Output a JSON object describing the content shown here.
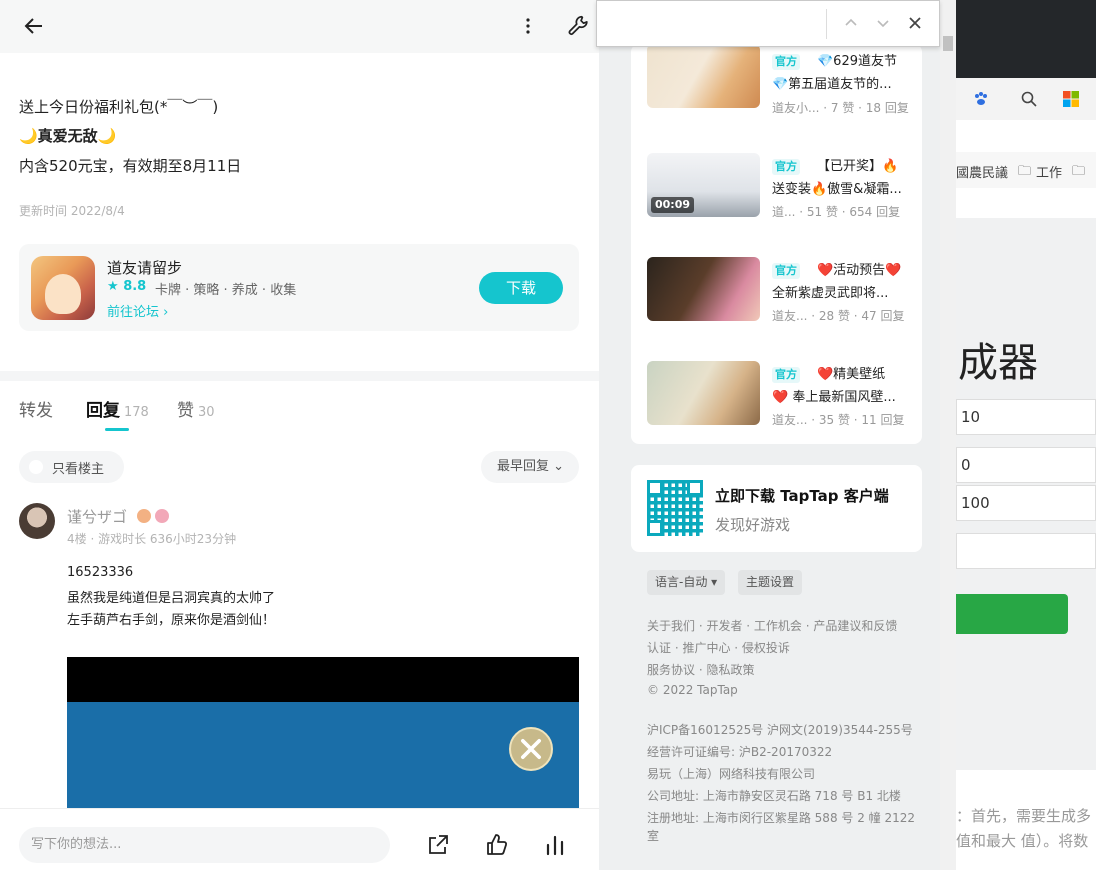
{
  "post": {
    "line1": "送上今日份福利礼包(*￣︶￣)",
    "line2": "🌙真爱无敌🌙",
    "line3": "内含520元宝，有效期至8月11日",
    "updated": "更新时间 2022/8/4"
  },
  "game": {
    "name": "道友请留步",
    "rating": "8.8",
    "tags": "卡牌 · 策略 · 养成 · 收集",
    "forum_link": "前往论坛 ›",
    "download_label": "下载"
  },
  "tabs": [
    {
      "label": "转发",
      "count": ""
    },
    {
      "label": "回复",
      "count": "178"
    },
    {
      "label": "赞",
      "count": "30"
    }
  ],
  "filters": {
    "only_owner": "只看楼主",
    "sort": "最早回复"
  },
  "comment": {
    "username": "谨兮ザゴ",
    "meta": "4楼 · 游戏时长 636小时23分钟",
    "lines": [
      "16523336",
      "虽然我是纯道但是吕洞宾真的太帅了",
      "左手葫芦右手剑，原来你是酒剑仙！"
    ]
  },
  "reply_placeholder": "写下你的想法...",
  "sidebar": {
    "posts": [
      {
        "tag": "官方",
        "title": "💎629道友节",
        "title2": "💎第五届道友节的...",
        "meta": "道友小... · 7 赞 · 18 回复",
        "duration": ""
      },
      {
        "tag": "官方",
        "title": "【已开奖】🔥",
        "title2": "送变装🔥傲雪&凝霜...",
        "meta": "道... · 51 赞 · 654 回复",
        "duration": "00:09"
      },
      {
        "tag": "官方",
        "title": "❤️活动预告❤️",
        "title2": "全新紫虚灵武即将...",
        "meta": "道友... · 28 赞 · 47 回复",
        "duration": ""
      },
      {
        "tag": "官方",
        "title": "❤️精美壁纸",
        "title2": "❤️ 奉上最新国风壁...",
        "meta": "道友... · 35 赞 · 11 回复",
        "duration": ""
      }
    ],
    "download": {
      "title": "立即下载 TapTap 客户端",
      "subtitle": "发现好游戏"
    },
    "language": "语言-自动 ▾",
    "theme": "主题设置",
    "footer_links": [
      "关于我们 · 开发者 · 工作机会 · 产品建议和反馈",
      "认证 · 推广中心 · 侵权投诉",
      "服务协议 · 隐私政策",
      "© 2022 TapTap"
    ],
    "footer_legal": [
      "沪ICP备16012525号    沪网文(2019)3544-255号",
      "经营许可证编号: 沪B2-20170322",
      "易玩（上海）网络科技有限公司",
      "公司地址: 上海市静安区灵石路 718 号 B1 北楼",
      "注册地址: 上海市闵行区紫星路 588 号 2 幢 2122",
      "室"
    ]
  },
  "bg_window": {
    "bookmarks": [
      "國農民議",
      "工作"
    ],
    "heading": "成器",
    "fields": [
      "10",
      "0",
      "100"
    ],
    "text1": "：首先，需要生成多",
    "text2": "值和最大 值）。将数"
  },
  "colors": {
    "accent": "#15c5ce",
    "green": "#28a745"
  }
}
